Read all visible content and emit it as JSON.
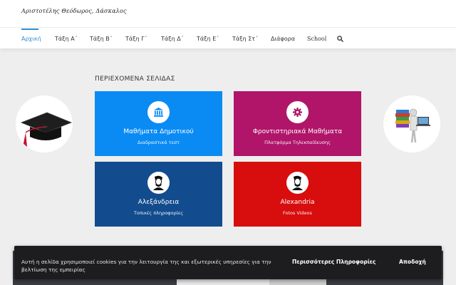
{
  "header": {
    "site_title": "Αριστοτέλης Θεόδωρος, Δάσκαλος",
    "nav": [
      {
        "label": "Αρχική"
      },
      {
        "label": "Τάξη Α΄"
      },
      {
        "label": "Τάξη Β΄"
      },
      {
        "label": "Τάξη Γ΄"
      },
      {
        "label": "Τάξη Δ΄"
      },
      {
        "label": "Τάξη Ε΄"
      },
      {
        "label": "Τάξη Στ΄"
      },
      {
        "label": "Διάφορα"
      },
      {
        "label": "School"
      }
    ],
    "search_icon": "search-icon",
    "accent_color": "#2e8ece"
  },
  "main": {
    "heading": "ΠΕΡΙΕΧΟΜΕΝΑ ΣΕΛΙΔΑΣ",
    "cards": [
      {
        "title": "Μαθήματα Δημοτικού",
        "subtitle": "Διαδραστικά τεστ",
        "icon": "bank-icon",
        "color": "#0a8bf4"
      },
      {
        "title": "Φροντιστηριακά Μαθήματα",
        "subtitle": "Πλατφόρμα Τηλεκπαίδευσης",
        "icon": "gear-icon",
        "color": "#b0156a"
      },
      {
        "title": "Αλεξάνδρεια",
        "subtitle": "Τοπικές πληροφορίες",
        "icon": "portrait-icon",
        "color": "#124c8e"
      },
      {
        "title": "Alexandria",
        "subtitle": "Fotos Videos",
        "icon": "portrait-icon",
        "color": "#d80d0d"
      }
    ],
    "left_image": "graduation-cap-icon",
    "right_image": "books-robot-icon"
  },
  "cookie": {
    "text": "Αυτή η σελίδα χρησιμοποιεί cookies για την λειτουργία της και εξωτερικές υπηρεσίες για την βελτίωση της εμπειρίας",
    "more_label": "Περισσότερες Πληροφορίες",
    "accept_label": "Αποδοχή"
  }
}
